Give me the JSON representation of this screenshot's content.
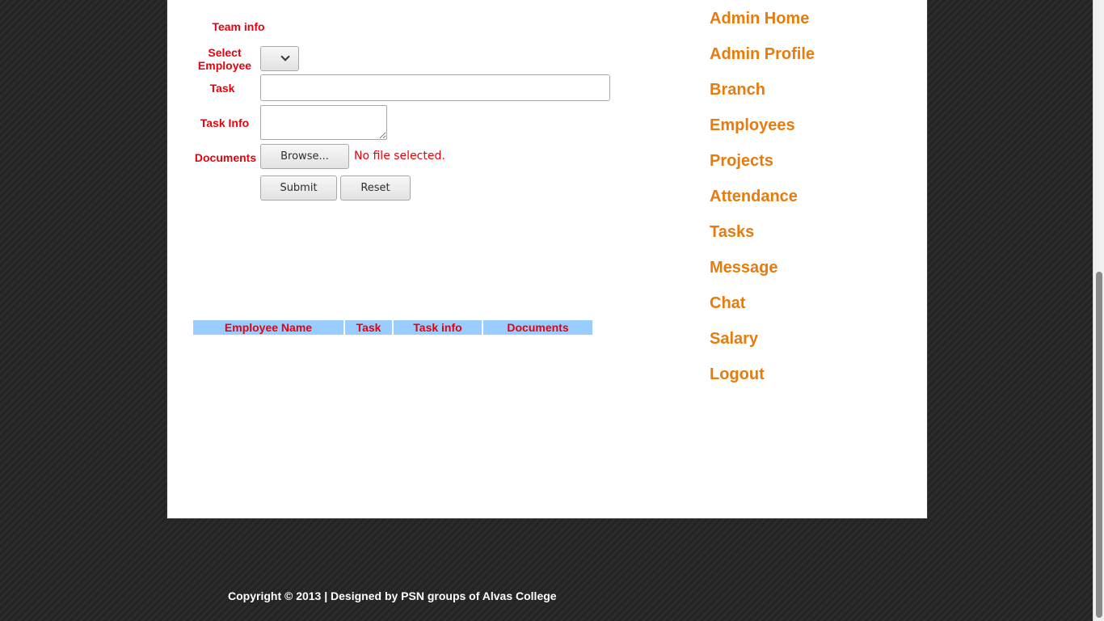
{
  "form": {
    "team_info_label": "Team info",
    "select_employee_label_line1": "Select",
    "select_employee_label_line2": "Employee",
    "task_label": "Task",
    "task_value": "",
    "task_info_label": "Task Info",
    "task_info_value": "",
    "documents_label": "Documents",
    "browse_label": "Browse...",
    "file_status": "No file selected.",
    "submit_label": "Submit",
    "reset_label": "Reset"
  },
  "table": {
    "headers": [
      "Employee Name",
      "Task",
      "Task info",
      "Documents"
    ],
    "rows": []
  },
  "nav": {
    "items": [
      {
        "label": "Admin Home"
      },
      {
        "label": "Admin Profile"
      },
      {
        "label": "Branch"
      },
      {
        "label": "Employees"
      },
      {
        "label": "Projects"
      },
      {
        "label": "Attendance"
      },
      {
        "label": "Tasks"
      },
      {
        "label": "Message"
      },
      {
        "label": "Chat"
      },
      {
        "label": "Salary"
      },
      {
        "label": "Logout"
      }
    ]
  },
  "footer": {
    "text": "Copyright © 2013 | Designed by PSN groups of Alvas College"
  },
  "colors": {
    "label_red": "#e8000b",
    "nav_orange": "#e87b0c",
    "table_header_bg": "#99ccff"
  }
}
